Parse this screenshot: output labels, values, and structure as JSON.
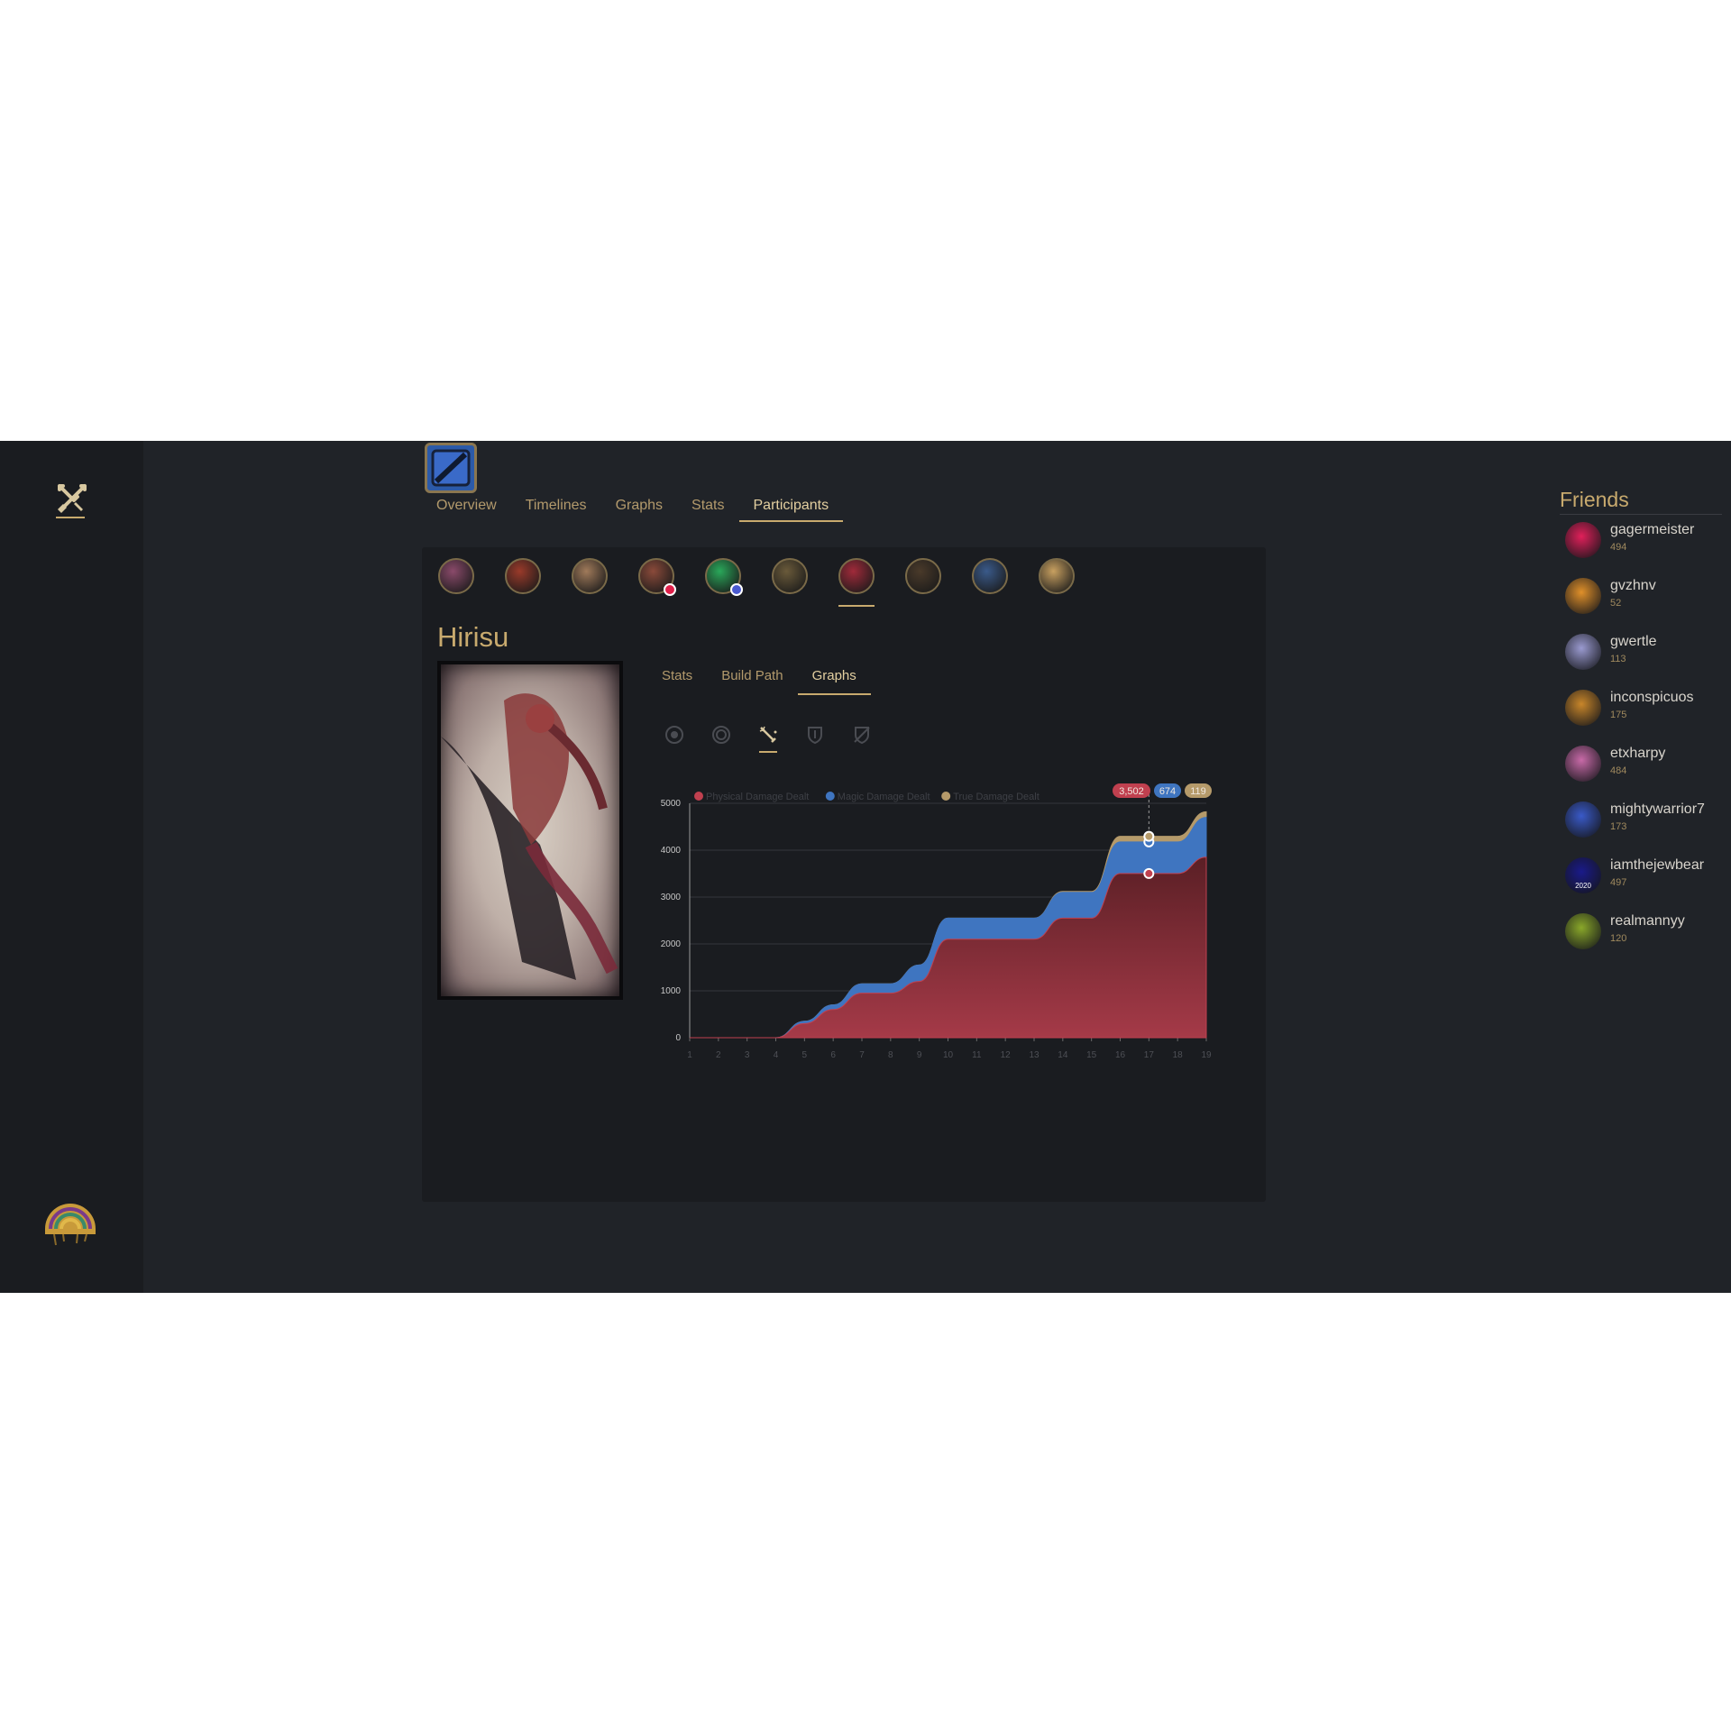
{
  "main_tabs": [
    {
      "label": "Overview",
      "active": false
    },
    {
      "label": "Timelines",
      "active": false
    },
    {
      "label": "Graphs",
      "active": false
    },
    {
      "label": "Stats",
      "active": false
    },
    {
      "label": "Participants",
      "active": true
    }
  ],
  "participants": [
    {
      "icon": "champion-portrait-1",
      "color": "#8a4a6a"
    },
    {
      "icon": "champion-portrait-2",
      "color": "#9a3a2a"
    },
    {
      "icon": "champion-portrait-3",
      "color": "#a07a5a"
    },
    {
      "icon": "champion-portrait-4",
      "color": "#8a4a3a"
    },
    {
      "icon": "champion-portrait-5",
      "color": "#2aa85a"
    },
    {
      "icon": "champion-portrait-6",
      "color": "#6a5a3a"
    },
    {
      "icon": "champion-portrait-7",
      "color": "#a02a3a",
      "active": true
    },
    {
      "icon": "champion-portrait-8",
      "color": "#4a3a2a"
    },
    {
      "icon": "champion-portrait-9",
      "color": "#3a5a8a"
    },
    {
      "icon": "champion-portrait-10",
      "color": "#c8a060"
    }
  ],
  "player": {
    "name": "Hirisu"
  },
  "sub_tabs": [
    {
      "label": "Stats",
      "active": false
    },
    {
      "label": "Build Path",
      "active": false
    },
    {
      "label": "Graphs",
      "active": true
    }
  ],
  "stat_icons": [
    "gold-icon",
    "experience-icon",
    "damage-dealt-icon",
    "damage-taken-icon",
    "mitigated-icon"
  ],
  "friends": {
    "title": "Friends",
    "items": [
      {
        "name": "gagermeister",
        "level": "494",
        "avatar_color": "#e0205a"
      },
      {
        "name": "gvzhnv",
        "level": "52",
        "avatar_color": "#e0902a"
      },
      {
        "name": "gwertle",
        "level": "113",
        "avatar_color": "#9a9ad0"
      },
      {
        "name": "inconspicuos",
        "level": "175",
        "avatar_color": "#c8862a"
      },
      {
        "name": "etxharpy",
        "level": "484",
        "avatar_color": "#c86aa8"
      },
      {
        "name": "mightywarrior7",
        "level": "173",
        "avatar_color": "#3a5ac8"
      },
      {
        "name": "iamthejewbear",
        "level": "497",
        "avatar_color": "#1a1a8a",
        "badge": "2020"
      },
      {
        "name": "realmannyy",
        "level": "120",
        "avatar_color": "#8aa82a"
      }
    ]
  },
  "chart_data": {
    "type": "area",
    "stacked": true,
    "x": [
      1,
      2,
      3,
      4,
      5,
      6,
      7,
      8,
      9,
      10,
      11,
      12,
      13,
      14,
      15,
      16,
      17,
      18,
      19
    ],
    "ylim": [
      0,
      5000
    ],
    "yticks": [
      "0",
      "1000",
      "2000",
      "3000",
      "4000",
      "5000"
    ],
    "series": [
      {
        "name": "Physical Damage Dealt",
        "color": "#c0404f",
        "values": [
          0,
          0,
          0,
          0,
          300,
          600,
          950,
          950,
          1200,
          2100,
          2100,
          2100,
          2100,
          2550,
          2550,
          3502,
          3502,
          3502,
          3850
        ]
      },
      {
        "name": "Magic Damage Dealt",
        "color": "#3f75c0",
        "values": [
          0,
          0,
          0,
          0,
          50,
          100,
          200,
          200,
          350,
          450,
          450,
          450,
          450,
          550,
          550,
          674,
          674,
          674,
          850
        ]
      },
      {
        "name": "True Damage Dealt",
        "color": "#b59a6a",
        "values": [
          0,
          0,
          0,
          0,
          0,
          0,
          0,
          0,
          0,
          0,
          0,
          0,
          0,
          20,
          20,
          119,
          119,
          119,
          120
        ]
      }
    ],
    "hover": {
      "x": 17,
      "labels": [
        "3,502",
        "674",
        "119"
      ]
    }
  }
}
